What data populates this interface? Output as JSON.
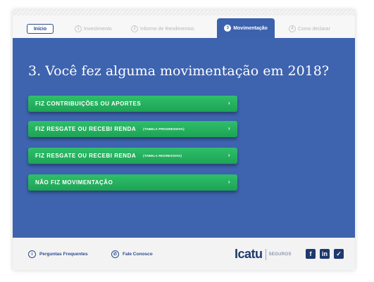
{
  "tabs": {
    "home": "Início",
    "items": [
      {
        "num": "1",
        "label": "Investimento"
      },
      {
        "num": "2",
        "label": "Informe de Rendimentos"
      },
      {
        "num": "3",
        "label": "Movimentação"
      },
      {
        "num": "4",
        "label": "Como declarar"
      }
    ],
    "active_index": 2
  },
  "main": {
    "question": "3. Você fez alguma movimentação em 2018?",
    "options": [
      {
        "label": "FIZ CONTRIBUIÇÕES OU APORTES",
        "sub": "",
        "chevron": "›"
      },
      {
        "label": "FIZ RESGATE OU RECEBI RENDA",
        "sub": "(TABELA PROGRESSIVA)",
        "chevron": "›"
      },
      {
        "label": "FIZ RESGATE OU RECEBI RENDA",
        "sub": "(TABELA REGRESSIVA)",
        "chevron": "›"
      },
      {
        "label": "NÃO FIZ MOVIMENTAÇÃO",
        "sub": "",
        "chevron": "›"
      }
    ]
  },
  "footer": {
    "faq": "Perguntas Frequentes",
    "contact": "Fale Conosco",
    "brand": "Icatu",
    "brand_sub": "SEGUROS",
    "social": [
      "facebook-icon",
      "linkedin-icon",
      "twitter-icon"
    ]
  },
  "colors": {
    "blue": "#3e63af",
    "green": "#24b05e",
    "navy": "#1e3a6e"
  }
}
